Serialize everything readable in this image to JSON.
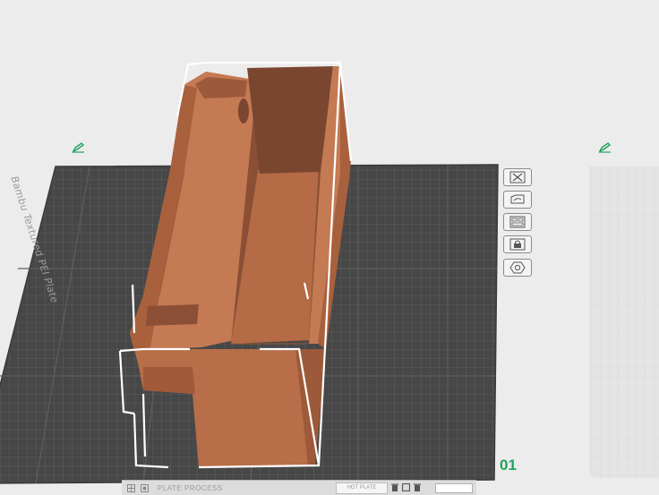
{
  "plate": {
    "name": "Bambu Textured PEI Plate",
    "index": "01",
    "index_color": "#1fa35b",
    "edit_icon": "pencil-icon"
  },
  "plate_toolbar": [
    {
      "name": "delete-plate",
      "icon": "close-icon"
    },
    {
      "name": "arrange-plate",
      "icon": "arrange-icon"
    },
    {
      "name": "auto-orient-plate",
      "icon": "layout-icon"
    },
    {
      "name": "lock-plate",
      "icon": "lock-icon"
    },
    {
      "name": "plate-settings",
      "icon": "settings-icon"
    }
  ],
  "bottom_bar": {
    "text": "PLATE PROCESS",
    "hint": "HOT PLATE"
  },
  "colors": {
    "background": "#ececec",
    "plate": "#4a4a4a",
    "grid": "#777777",
    "model": "#c47a53",
    "accent": "#1fa35b",
    "selection": "#ffffff"
  }
}
